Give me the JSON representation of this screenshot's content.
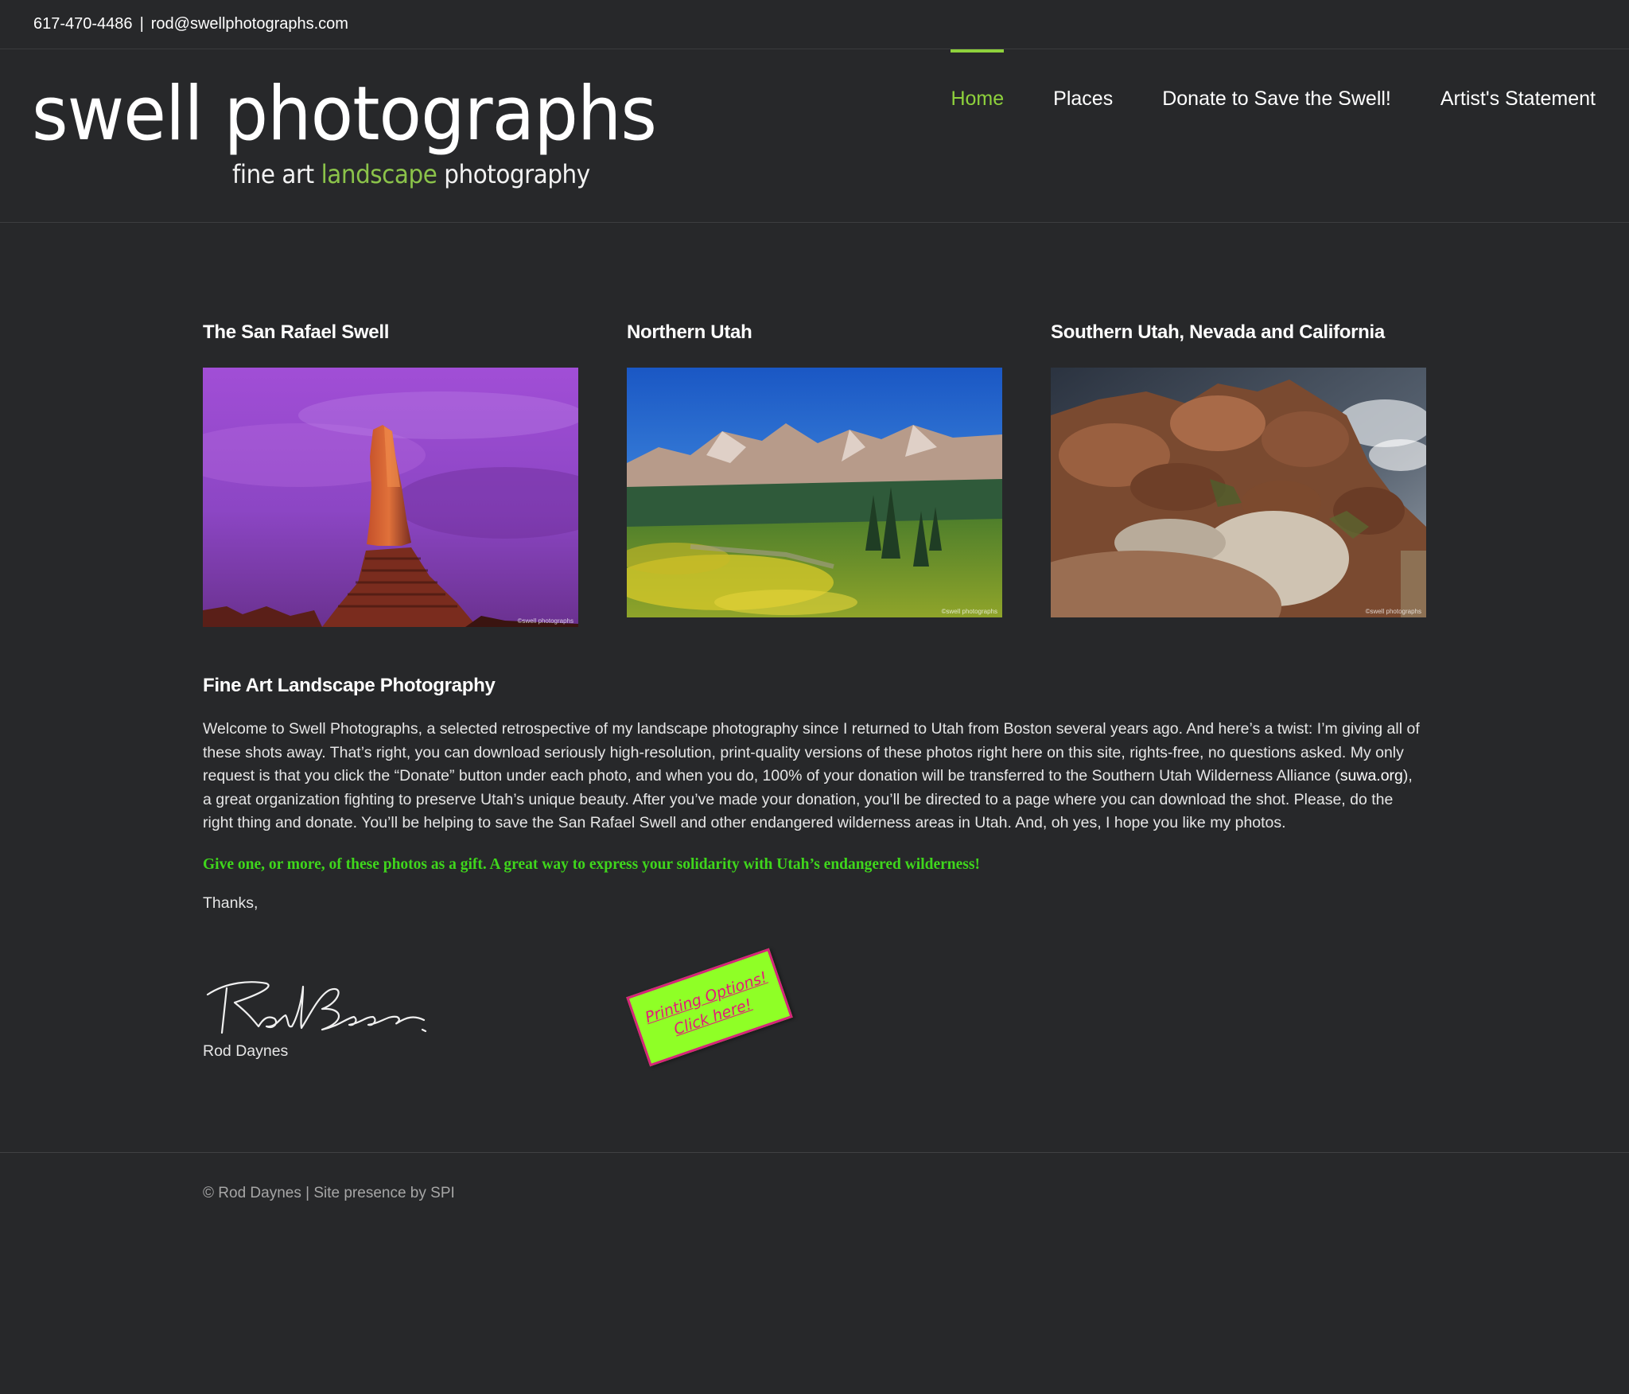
{
  "topbar": {
    "phone": "617-470-4486",
    "separator": "|",
    "email": "rod@swellphotographs.com"
  },
  "logo": {
    "main": "swell photographs",
    "tag_part1": "fine art ",
    "tag_accent": "landscape",
    "tag_part2": " photography"
  },
  "nav": {
    "items": [
      {
        "label": "Home",
        "active": true
      },
      {
        "label": "Places",
        "active": false
      },
      {
        "label": "Donate to Save the Swell!",
        "active": false
      },
      {
        "label": "Artist's Statement",
        "active": false
      }
    ]
  },
  "gallery": [
    {
      "title": "The San Rafael Swell",
      "watermark": "©swell photographs"
    },
    {
      "title": "Northern Utah",
      "watermark": "©swell photographs"
    },
    {
      "title": "Southern Utah, Nevada and California",
      "watermark": "©swell photographs"
    }
  ],
  "intro": {
    "heading": "Fine Art Landscape Photography",
    "body_part1": "Welcome to Swell Photographs, a selected retrospective of my landscape photography since I returned to Utah from Boston several years ago. And here’s a twist: I’m giving all of these shots away. That’s right, you can download seriously high-resolution, print-quality versions of these photos right here on this site, rights-free, no questions asked. My only request is that you click the “Donate” button under each photo, and when you do, 100% of your donation will be transferred to the Southern Utah Wilderness Alliance (",
    "body_link": "suwa.org",
    "body_part2": "), a great organization fighting to preserve Utah’s unique beauty. After you’ve made your donation, you’ll be directed to a page where you can download the shot. Please, do the right thing and donate. You’ll  be helping to save the San Rafael Swell and other endangered wilderness areas in Utah. And, oh yes, I hope you like my photos.",
    "gift": "Give one, or more, of these photos as a gift. A great way to express your solidarity with Utah’s endangered wilderness!",
    "thanks": "Thanks,",
    "signature_name": "Rod Daynes"
  },
  "print_sticker": {
    "line1": "Printing Options!",
    "line2": "Click here!"
  },
  "footer": {
    "copyright": "© Rod Daynes",
    "separator": "|",
    "credit": "Site presence by SPI"
  },
  "colors": {
    "background": "#27282a",
    "accent_green": "#8ed13c",
    "gift_green": "#3fd61c",
    "sticker_bg": "#8fff26",
    "sticker_text": "#e3197a"
  }
}
